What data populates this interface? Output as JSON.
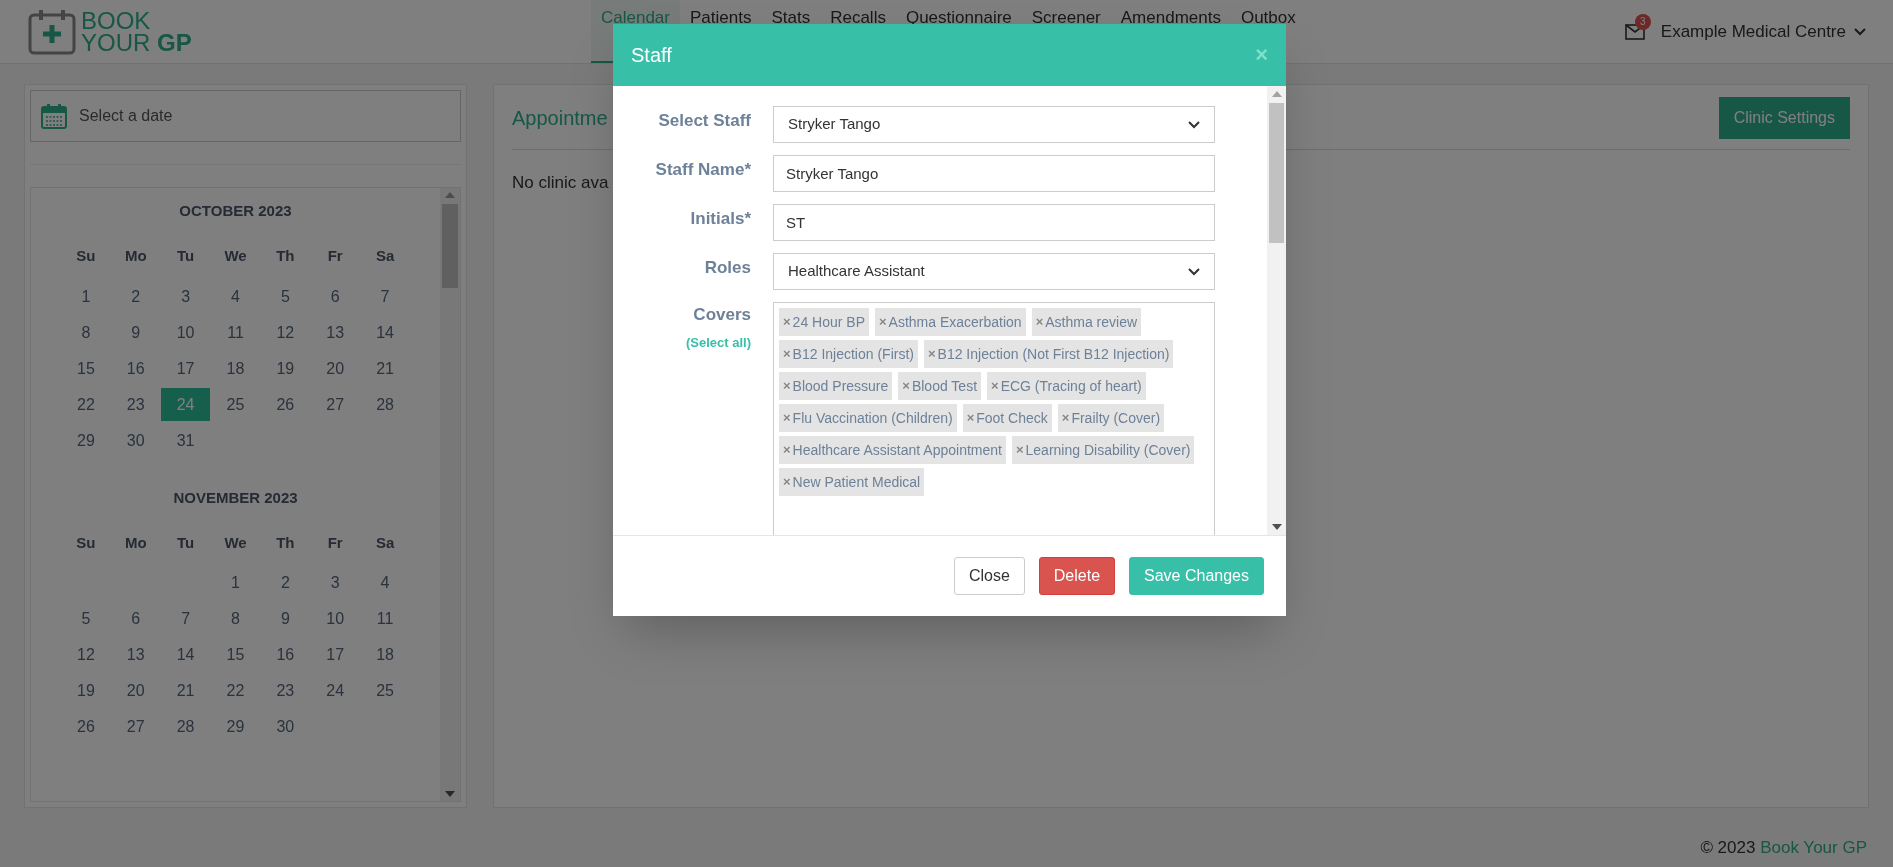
{
  "header": {
    "logo": {
      "line1": "BOOK",
      "line2a": "YOUR",
      "line2b": "GP"
    },
    "nav": [
      {
        "label": "Calendar",
        "selected": true
      },
      {
        "label": "Patients",
        "selected": false
      },
      {
        "label": "Stats",
        "selected": false
      },
      {
        "label": "Recalls",
        "selected": false
      },
      {
        "label": "Questionnaire",
        "selected": false
      },
      {
        "label": "Screener",
        "selected": false
      },
      {
        "label": "Amendments",
        "selected": false
      },
      {
        "label": "Outbox",
        "selected": false
      }
    ],
    "mail_badge": "3",
    "practice": "Example Medical Centre"
  },
  "date_picker": {
    "placeholder": "Select a date"
  },
  "months": [
    {
      "title": "OCTOBER 2023",
      "weekdays": [
        "Su",
        "Mo",
        "Tu",
        "We",
        "Th",
        "Fr",
        "Sa"
      ],
      "days": [
        {
          "kind": "day",
          "label": "1",
          "selected": false
        },
        {
          "kind": "day",
          "label": "2",
          "selected": false
        },
        {
          "kind": "day",
          "label": "3",
          "selected": false
        },
        {
          "kind": "day",
          "label": "4",
          "selected": false
        },
        {
          "kind": "day",
          "label": "5",
          "selected": false
        },
        {
          "kind": "day",
          "label": "6",
          "selected": false
        },
        {
          "kind": "day",
          "label": "7",
          "selected": false
        },
        {
          "kind": "day",
          "label": "8",
          "selected": false
        },
        {
          "kind": "day",
          "label": "9",
          "selected": false
        },
        {
          "kind": "day",
          "label": "10",
          "selected": false
        },
        {
          "kind": "day",
          "label": "11",
          "selected": false
        },
        {
          "kind": "day",
          "label": "12",
          "selected": false
        },
        {
          "kind": "day",
          "label": "13",
          "selected": false
        },
        {
          "kind": "day",
          "label": "14",
          "selected": false
        },
        {
          "kind": "day",
          "label": "15",
          "selected": false
        },
        {
          "kind": "day",
          "label": "16",
          "selected": false
        },
        {
          "kind": "day",
          "label": "17",
          "selected": false
        },
        {
          "kind": "day",
          "label": "18",
          "selected": false
        },
        {
          "kind": "day",
          "label": "19",
          "selected": false
        },
        {
          "kind": "day",
          "label": "20",
          "selected": false
        },
        {
          "kind": "day",
          "label": "21",
          "selected": false
        },
        {
          "kind": "day",
          "label": "22",
          "selected": false
        },
        {
          "kind": "day",
          "label": "23",
          "selected": false
        },
        {
          "kind": "day",
          "label": "24",
          "selected": true
        },
        {
          "kind": "day",
          "label": "25",
          "selected": false
        },
        {
          "kind": "day",
          "label": "26",
          "selected": false
        },
        {
          "kind": "day",
          "label": "27",
          "selected": false
        },
        {
          "kind": "day",
          "label": "28",
          "selected": false
        },
        {
          "kind": "day",
          "label": "29",
          "selected": false
        },
        {
          "kind": "day",
          "label": "30",
          "selected": false
        },
        {
          "kind": "day",
          "label": "31",
          "selected": false
        }
      ]
    },
    {
      "title": "NOVEMBER 2023",
      "weekdays": [
        "Su",
        "Mo",
        "Tu",
        "We",
        "Th",
        "Fr",
        "Sa"
      ],
      "days": [
        {
          "kind": "blank"
        },
        {
          "kind": "blank"
        },
        {
          "kind": "blank"
        },
        {
          "kind": "day",
          "label": "1",
          "selected": false
        },
        {
          "kind": "day",
          "label": "2",
          "selected": false
        },
        {
          "kind": "day",
          "label": "3",
          "selected": false
        },
        {
          "kind": "day",
          "label": "4",
          "selected": false
        },
        {
          "kind": "day",
          "label": "5",
          "selected": false
        },
        {
          "kind": "day",
          "label": "6",
          "selected": false
        },
        {
          "kind": "day",
          "label": "7",
          "selected": false
        },
        {
          "kind": "day",
          "label": "8",
          "selected": false
        },
        {
          "kind": "day",
          "label": "9",
          "selected": false
        },
        {
          "kind": "day",
          "label": "10",
          "selected": false
        },
        {
          "kind": "day",
          "label": "11",
          "selected": false
        },
        {
          "kind": "day",
          "label": "12",
          "selected": false
        },
        {
          "kind": "day",
          "label": "13",
          "selected": false
        },
        {
          "kind": "day",
          "label": "14",
          "selected": false
        },
        {
          "kind": "day",
          "label": "15",
          "selected": false
        },
        {
          "kind": "day",
          "label": "16",
          "selected": false
        },
        {
          "kind": "day",
          "label": "17",
          "selected": false
        },
        {
          "kind": "day",
          "label": "18",
          "selected": false
        },
        {
          "kind": "day",
          "label": "19",
          "selected": false
        },
        {
          "kind": "day",
          "label": "20",
          "selected": false
        },
        {
          "kind": "day",
          "label": "21",
          "selected": false
        },
        {
          "kind": "day",
          "label": "22",
          "selected": false
        },
        {
          "kind": "day",
          "label": "23",
          "selected": false
        },
        {
          "kind": "day",
          "label": "24",
          "selected": false
        },
        {
          "kind": "day",
          "label": "25",
          "selected": false
        },
        {
          "kind": "day",
          "label": "26",
          "selected": false
        },
        {
          "kind": "day",
          "label": "27",
          "selected": false
        },
        {
          "kind": "day",
          "label": "28",
          "selected": false
        },
        {
          "kind": "day",
          "label": "29",
          "selected": false
        },
        {
          "kind": "day",
          "label": "30",
          "selected": false
        }
      ]
    }
  ],
  "main": {
    "title": "Appointme",
    "clinic_settings": "Clinic Settings",
    "message": "No clinic ava"
  },
  "footer": {
    "copyright": "© 2023",
    "link": "Book Your GP"
  },
  "modal": {
    "title": "Staff",
    "close": "×",
    "fields": [
      {
        "kind": "select",
        "label": "Select Staff",
        "value": "Stryker Tango"
      },
      {
        "kind": "text",
        "label": "Staff Name*",
        "value": "Stryker Tango"
      },
      {
        "kind": "text",
        "label": "Initials*",
        "value": "ST"
      },
      {
        "kind": "select",
        "label": "Roles",
        "value": "Healthcare Assistant"
      }
    ],
    "covers": {
      "label": "Covers",
      "select_all": "(Select all)",
      "remove": "×",
      "tags": [
        "24 Hour BP",
        "Asthma Exacerbation",
        "Asthma review",
        "B12 Injection (First)",
        "B12 Injection (Not First B12 Injection)",
        "Blood Pressure",
        "Blood Test",
        "ECG (Tracing of heart)",
        "Flu Vaccination (Children)",
        "Foot Check",
        "Frailty (Cover)",
        "Healthcare Assistant Appointment",
        "Learning Disability (Cover)",
        "New Patient Medical"
      ]
    },
    "buttons": [
      {
        "kind": "close",
        "label": "Close"
      },
      {
        "kind": "delete",
        "label": "Delete"
      },
      {
        "kind": "save",
        "label": "Save Changes"
      }
    ]
  }
}
